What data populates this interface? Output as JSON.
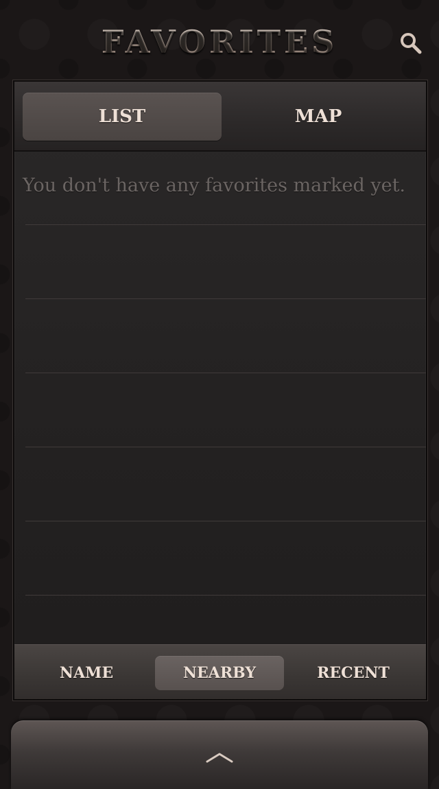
{
  "header": {
    "title": "FAVORITES",
    "search_icon": "search-icon"
  },
  "view_toggle": {
    "list_label": "LIST",
    "map_label": "MAP",
    "selected": "LIST"
  },
  "list": {
    "empty_message": "You don't have any favorites marked yet."
  },
  "sort_tabs": {
    "name_label": "NAME",
    "nearby_label": "NEARBY",
    "recent_label": "RECENT",
    "selected": "NEARBY"
  },
  "drawer": {
    "icon": "chevron-up-icon"
  },
  "colors": {
    "background": "#1b1717",
    "title_text": "#d9c7bb",
    "label_text": "#eee0d6",
    "muted_text": "#6b6563"
  }
}
